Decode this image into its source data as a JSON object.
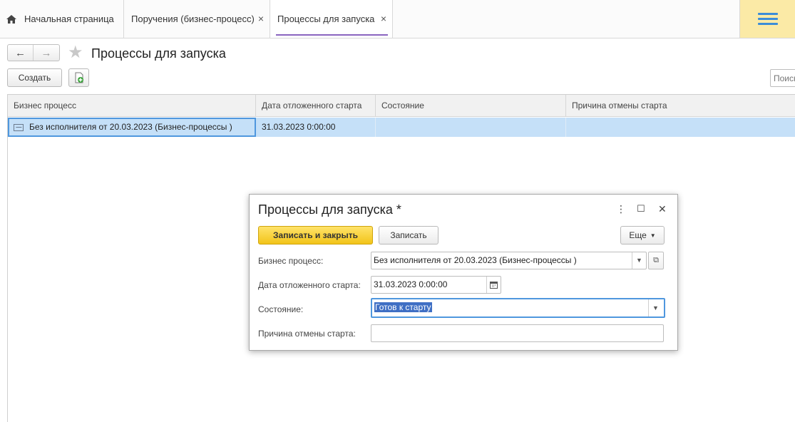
{
  "tabs": {
    "home": "Начальная страница",
    "tasks": "Поручения (бизнес-процесс)",
    "active": "Процессы для запуска",
    "close_glyph": "×"
  },
  "nav": {
    "back": "←",
    "forward": "→"
  },
  "page": {
    "title": "Процессы для запуска"
  },
  "toolbar": {
    "create_label": "Создать",
    "search_placeholder": "Поиск"
  },
  "table": {
    "columns": [
      "Бизнес процесс",
      "Дата отложенного старта",
      "Состояние",
      "Причина отмены старта"
    ],
    "rows": [
      {
        "process": "Без исполнителя от 20.03.2023 (Бизнес-процессы )",
        "date": "31.03.2023 0:00:00",
        "state": "",
        "reason": ""
      }
    ]
  },
  "modal": {
    "title": "Процессы для запуска *",
    "icons": {
      "more": "⋮",
      "maximize": "☐",
      "close": "✕"
    },
    "save_close_label": "Записать и закрыть",
    "save_label": "Записать",
    "more_label": "Еще",
    "fields": {
      "process_label": "Бизнес процесс:",
      "process_value": "Без исполнителя от 20.03.2023 (Бизнес-процессы )",
      "date_label": "Дата отложенного старта:",
      "date_value": "31.03.2023  0:00:00",
      "state_label": "Состояние:",
      "state_value": "Готов к старту",
      "reason_label": "Причина отмены старта:",
      "reason_value": ""
    }
  },
  "colors": {
    "accent": "#8a64bf",
    "selection": "#c5e0f8",
    "primary_button": "#f2c419",
    "menu_bg": "#fbeaa6"
  }
}
